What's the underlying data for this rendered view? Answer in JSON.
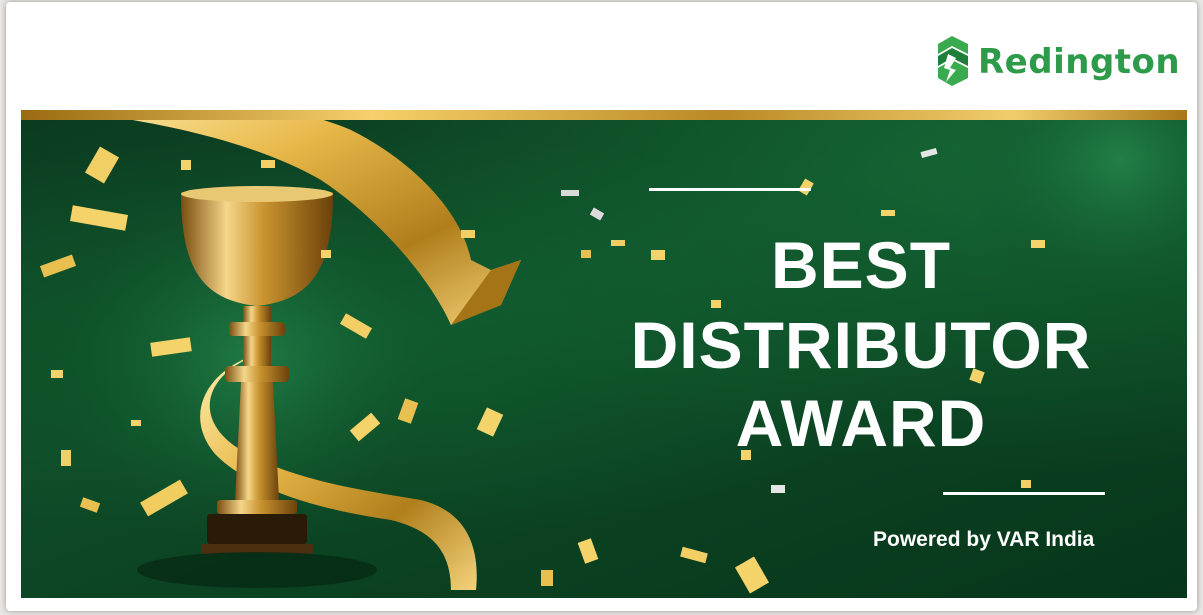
{
  "brand": {
    "name": "Redington",
    "color": "#2e9b4a",
    "logo_icon": "redington-logo-icon"
  },
  "award": {
    "title_line1": "BEST",
    "title_line2": "DISTRIBUTOR",
    "title_line3": "AWARD",
    "powered_by": "Powered by VAR India"
  },
  "colors": {
    "banner_green": "#0e4a27",
    "gold": "#e8b84a",
    "text": "#ffffff"
  },
  "icons": {
    "trophy": "trophy-icon",
    "ribbon": "ribbon-decoration",
    "confetti": "confetti-decoration"
  }
}
